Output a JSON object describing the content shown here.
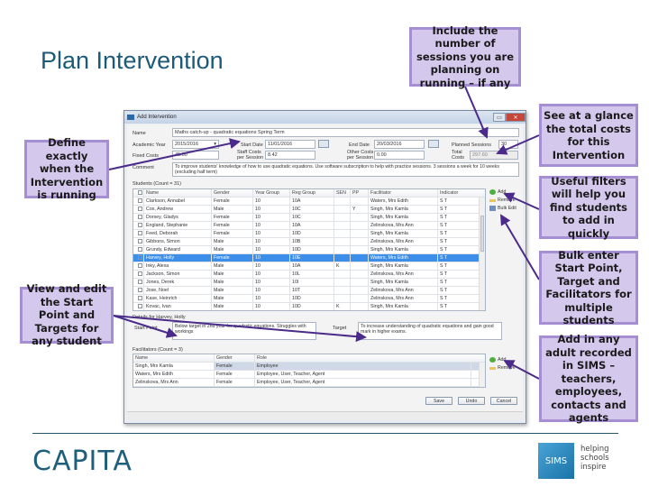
{
  "slide": {
    "title": "Plan Intervention",
    "callouts": {
      "sessions": "Include the number of sessions you are planning on running – if any",
      "total_costs": "See at a glance the total costs for this Intervention",
      "filters": "Useful filters will help you find students to add in quickly",
      "bulk": "Bulk enter Start Point, Target and Facilitators for multiple students",
      "adults": "Add in any adult recorded in SIMS – teachers, employees, contacts and agents",
      "define": "Define exactly when the Intervention is running",
      "view_edit": "View and edit the Start Point and Targets for any student"
    },
    "colors": {
      "callout_fill": "#d4c8ec",
      "callout_border": "#a58ed2",
      "arrow": "#4a2a8a",
      "brand": "#1f5f7b"
    }
  },
  "dialog": {
    "title": "Add Intervention",
    "window_buttons": {
      "minimize": "▭",
      "close": "✕"
    },
    "fields": {
      "name_label": "Name",
      "name_value": "Maths catch-up - quadratic equations Spring Term",
      "academic_year_label": "Academic Year",
      "academic_year_value": "2015/2016",
      "start_date_label": "Start Date",
      "start_date_value": "11/01/2016",
      "end_date_label": "End Date",
      "end_date_value": "20/03/2016",
      "planned_sessions_label": "Planned Sessions",
      "planned_sessions_value": "30",
      "fixed_costs_label": "Fixed Costs",
      "fixed_costs_value": "45.00",
      "staff_costs_label": "Staff Costs per Session",
      "staff_costs_value": "8.42",
      "other_costs_label": "Other Costs per Session",
      "other_costs_value": "0.00",
      "total_costs_label": "Total Costs",
      "total_costs_value": "297.60",
      "comment_label": "Comment",
      "comment_value": "To improve students' knowledge of how to use quadratic equations. Use software subscription to help with practice sessions. 3 sessions a week for 10 weeks (excluding half term)"
    },
    "students": {
      "caption": "Students (Count = 31)",
      "columns": [
        "Name",
        "Gender",
        "Year Group",
        "Reg Group",
        "SEN",
        "PP",
        "Facilitator",
        "Indicator"
      ],
      "rows": [
        {
          "name": "Clarkson, Annabel",
          "gender": "Female",
          "year": "10",
          "reg": "10A",
          "sen": "",
          "pp": "",
          "facilitator": "Waters, Mrs Edith",
          "indicator": "S T",
          "checked": false,
          "selected": false
        },
        {
          "name": "Cox, Andrew",
          "gender": "Male",
          "year": "10",
          "reg": "10C",
          "sen": "",
          "pp": "Y",
          "facilitator": "Singh, Mrs Kamla",
          "indicator": "S T",
          "checked": false,
          "selected": false
        },
        {
          "name": "Dorsey, Gladys",
          "gender": "Female",
          "year": "10",
          "reg": "10C",
          "sen": "",
          "pp": "",
          "facilitator": "Singh, Mrs Kamla",
          "indicator": "S T",
          "checked": false,
          "selected": false
        },
        {
          "name": "England, Stephanie",
          "gender": "Female",
          "year": "10",
          "reg": "10A",
          "sen": "",
          "pp": "",
          "facilitator": "Zelinskova, Mrs Ann",
          "indicator": "S T",
          "checked": false,
          "selected": false
        },
        {
          "name": "Feed, Deborah",
          "gender": "Female",
          "year": "10",
          "reg": "10D",
          "sen": "",
          "pp": "",
          "facilitator": "Singh, Mrs Kamla",
          "indicator": "S T",
          "checked": false,
          "selected": false
        },
        {
          "name": "Gibbons, Simon",
          "gender": "Male",
          "year": "10",
          "reg": "10B",
          "sen": "",
          "pp": "",
          "facilitator": "Zelinskova, Mrs Ann",
          "indicator": "S T",
          "checked": false,
          "selected": false
        },
        {
          "name": "Grundy, Edward",
          "gender": "Male",
          "year": "10",
          "reg": "10D",
          "sen": "",
          "pp": "",
          "facilitator": "Singh, Mrs Kamla",
          "indicator": "S T",
          "checked": false,
          "selected": false
        },
        {
          "name": "Harvey, Holly",
          "gender": "Female",
          "year": "10",
          "reg": "10E",
          "sen": "",
          "pp": "",
          "facilitator": "Waters, Mrs Edith",
          "indicator": "S T",
          "checked": true,
          "selected": true
        },
        {
          "name": "Inky, Alexa",
          "gender": "Male",
          "year": "10",
          "reg": "10A",
          "sen": "K",
          "pp": "",
          "facilitator": "Singh, Mrs Kamla",
          "indicator": "S T",
          "checked": false,
          "selected": false
        },
        {
          "name": "Jackson, Simon",
          "gender": "Male",
          "year": "10",
          "reg": "10L",
          "sen": "",
          "pp": "",
          "facilitator": "Zelinskova, Mrs Ann",
          "indicator": "S T",
          "checked": false,
          "selected": false
        },
        {
          "name": "Jones, Derek",
          "gender": "Male",
          "year": "10",
          "reg": "10I",
          "sen": "",
          "pp": "",
          "facilitator": "Singh, Mrs Kamla",
          "indicator": "S T",
          "checked": false,
          "selected": false
        },
        {
          "name": "Jose, Noel",
          "gender": "Male",
          "year": "10",
          "reg": "10T",
          "sen": "",
          "pp": "",
          "facilitator": "Zelinskova, Mrs Ann",
          "indicator": "S T",
          "checked": false,
          "selected": false
        },
        {
          "name": "Kase, Heinrich",
          "gender": "Male",
          "year": "10",
          "reg": "10D",
          "sen": "",
          "pp": "",
          "facilitator": "Zelinskova, Mrs Ann",
          "indicator": "S T",
          "checked": false,
          "selected": false
        },
        {
          "name": "Kovac, Ivan",
          "gender": "Male",
          "year": "10",
          "reg": "10D",
          "sen": "K",
          "pp": "",
          "facilitator": "Singh, Mrs Kamla",
          "indicator": "S T",
          "checked": false,
          "selected": false
        }
      ],
      "actions": {
        "add": "Add",
        "remove": "Remove",
        "bulk_edit": "Bulk Edit"
      }
    },
    "details": {
      "caption": "Details for Harvey, Holly",
      "start_label": "Start Point",
      "start_value": "Below target in 2nd year for quadratic equations. Struggles with workings",
      "target_label": "Target",
      "target_value": "To increase understanding of quadratic equations and gain good mark in higher exams."
    },
    "facilitators": {
      "caption": "Facilitators (Count = 3)",
      "columns": [
        "Name",
        "Gender",
        "Role"
      ],
      "rows": [
        {
          "name": "Singh, Mrs Kamla",
          "gender": "Female",
          "role": "Employee",
          "selected": true
        },
        {
          "name": "Waters, Mrs Edith",
          "gender": "Female",
          "role": "Employee, User, Teacher, Agent",
          "selected": false
        },
        {
          "name": "Zelinskova, Mrs Ann",
          "gender": "Female",
          "role": "Employee, User, Teacher, Agent",
          "selected": false
        }
      ],
      "actions": {
        "add": "Add",
        "remove": "Remove"
      }
    },
    "buttons": {
      "save": "Save",
      "undo": "Undo",
      "cancel": "Cancel"
    }
  },
  "footer": {
    "brand": "CAPITA",
    "sims_logo": "SIMS",
    "tagline_1": "helping",
    "tagline_2": "schools",
    "tagline_3": "inspire"
  }
}
